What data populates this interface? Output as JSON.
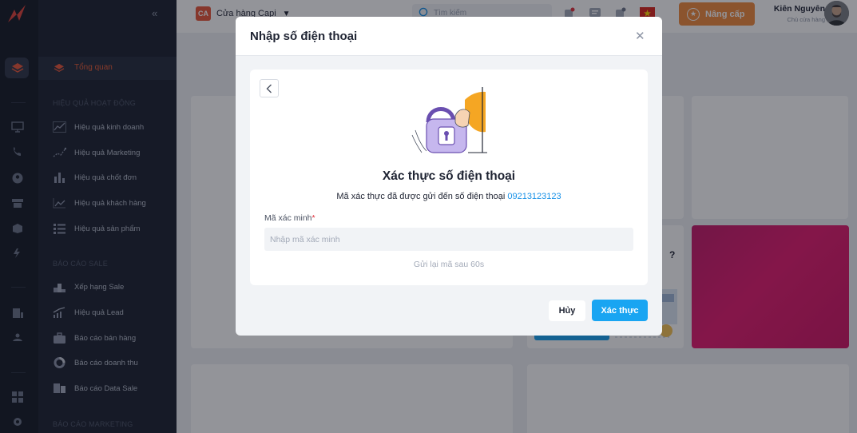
{
  "sidebar": {
    "overview_label": "Tổng quan",
    "sections": [
      {
        "title": "HIỆU QUẢ HOẠT ĐỘNG",
        "items": [
          "Hiệu quả kinh doanh",
          "Hiệu quả Marketing",
          "Hiệu quả chốt đơn",
          "Hiệu quả khách hàng",
          "Hiệu quả sản phẩm"
        ]
      },
      {
        "title": "BÁO CÁO SALE",
        "items": [
          "Xếp hạng Sale",
          "Hiệu quả Lead",
          "Báo cáo bán hàng",
          "Báo cáo doanh thu",
          "Báo cáo Data Sale"
        ]
      },
      {
        "title": "BÁO CÁO MARKETING",
        "items": []
      }
    ]
  },
  "topbar": {
    "store_badge": "CA",
    "store_name": "Cửa hàng Capi",
    "search_placeholder": "Tìm kiếm",
    "upgrade_label": "Nâng cấp",
    "user_name": "Kiên Nguyên",
    "user_role": "Chủ cửa hàng"
  },
  "background": {
    "question_mark": "?"
  },
  "modal": {
    "title": "Nhập số điện thoại",
    "heading": "Xác thực số điện thoại",
    "subtitle": "Mã xác thực đã được gửi đến số điện thoại",
    "phone": "09213123123",
    "field_label": "Mã xác minh",
    "required_mark": "*",
    "field_placeholder": "Nhập mã xác minh",
    "field_value": "",
    "resend_text": "Gửi lại mã sau 60s",
    "cancel_label": "Hủy",
    "confirm_label": "Xác thực"
  },
  "colors": {
    "accent": "#e85b36",
    "primary_button": "#19a5f2",
    "upgrade": "#f08a3c",
    "phone_link": "#1791e8"
  }
}
